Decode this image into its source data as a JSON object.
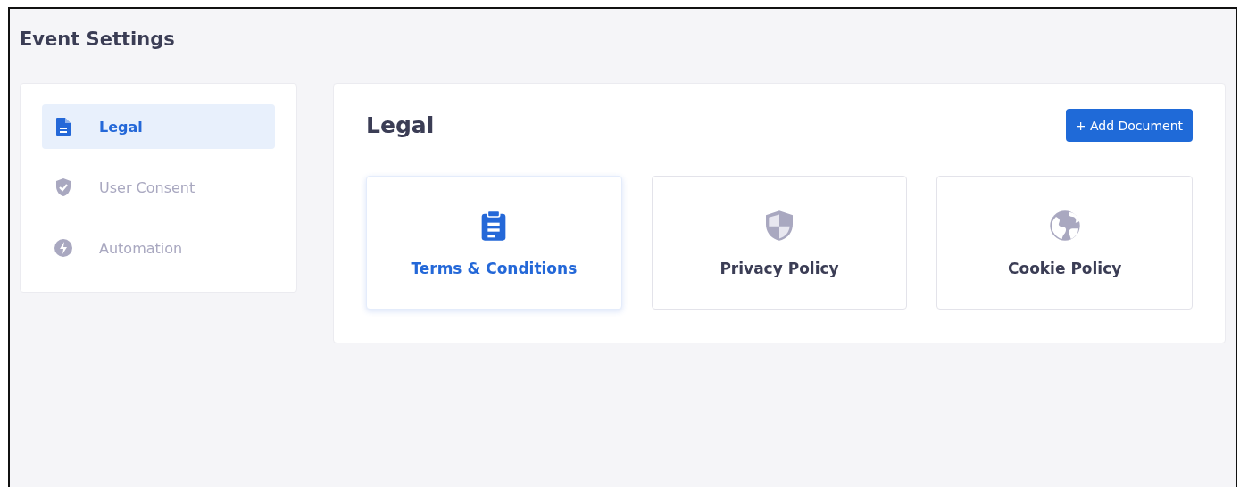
{
  "page": {
    "title": "Event Settings"
  },
  "sidebar": {
    "items": [
      {
        "label": "Legal",
        "selected": true
      },
      {
        "label": "User Consent",
        "selected": false
      },
      {
        "label": "Automation",
        "selected": false
      }
    ]
  },
  "panel": {
    "title": "Legal",
    "button": "+ Add Document",
    "documents": [
      {
        "label": "Terms & Conditions",
        "selected": true
      },
      {
        "label": "Privacy Policy",
        "selected": false
      },
      {
        "label": "Cookie Policy",
        "selected": false
      }
    ]
  }
}
